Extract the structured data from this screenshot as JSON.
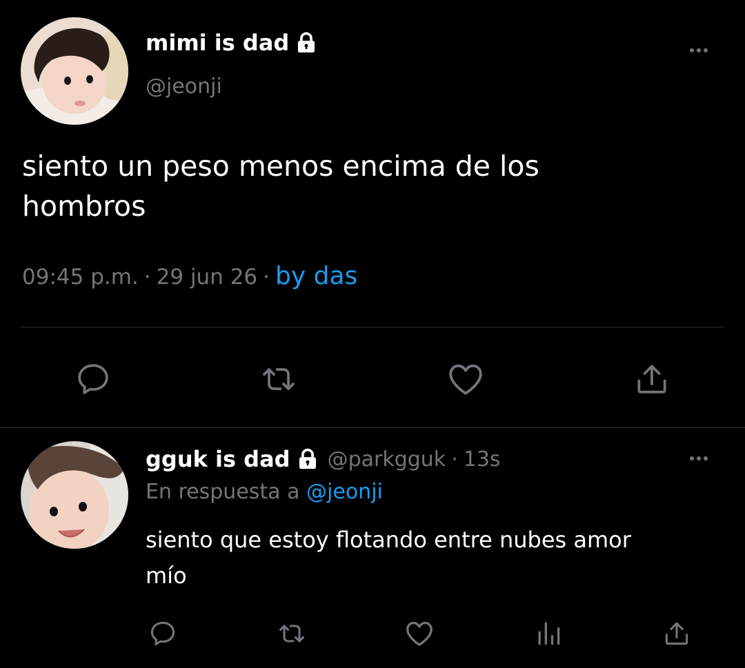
{
  "main_tweet": {
    "author_name": "mimi is dad",
    "handle": "@jeonji",
    "text_line1": "siento un peso menos encima de los",
    "text_line2": "hombros",
    "time": "09:45 p.m.",
    "separator1": "·",
    "date": "29 jun 26",
    "separator2": "·",
    "source": "by das"
  },
  "reply_tweet": {
    "author_name": "gguk is dad",
    "handle": "@parkgguk",
    "separator": "·",
    "time_ago": "13s",
    "reply_prefix": "En respuesta a",
    "reply_to": "@jeonji",
    "text_line1": "siento que estoy flotando entre nubes amor",
    "text_line2": "mío"
  },
  "icons": {
    "lock": "lock-icon",
    "more": "more-icon",
    "reply": "reply-icon",
    "retweet": "retweet-icon",
    "like": "like-icon",
    "share": "share-icon",
    "analytics": "analytics-icon"
  },
  "colors": {
    "background": "#000000",
    "text": "#e7e9ea",
    "muted": "#71767b",
    "accent": "#1d9bf0",
    "divider": "#2f3336"
  }
}
